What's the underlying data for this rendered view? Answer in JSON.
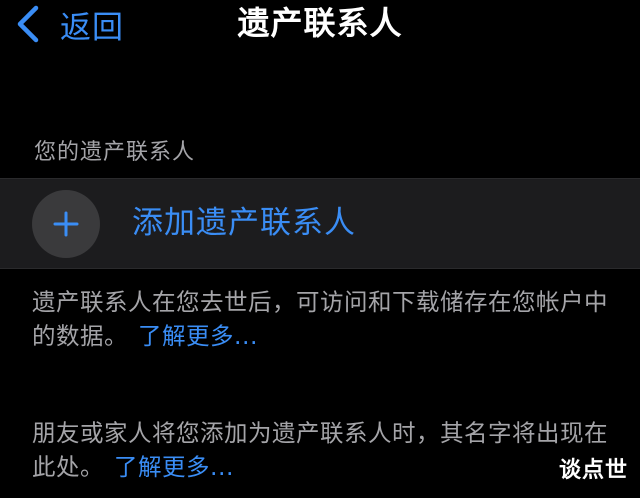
{
  "nav": {
    "back_label": "返回",
    "title": "遗产联系人"
  },
  "section": {
    "header": "您的遗产联系人"
  },
  "add_row": {
    "label": "添加遗产联系人",
    "icon": "plus-icon"
  },
  "descriptions": [
    {
      "text": "遗产联系人在您去世后，可访问和下载储存在您帐户中的数据。",
      "link": "了解更多..."
    },
    {
      "text": "朋友或家人将您添加为遗产联系人时，其名字将出现在此处。",
      "link": "了解更多..."
    }
  ],
  "watermark": "谈点世",
  "colors": {
    "background": "#000000",
    "accent": "#3a8df5",
    "secondary_text": "#a4a4a8",
    "row_background": "#1c1c1e",
    "icon_circle": "#3a3a3c"
  }
}
